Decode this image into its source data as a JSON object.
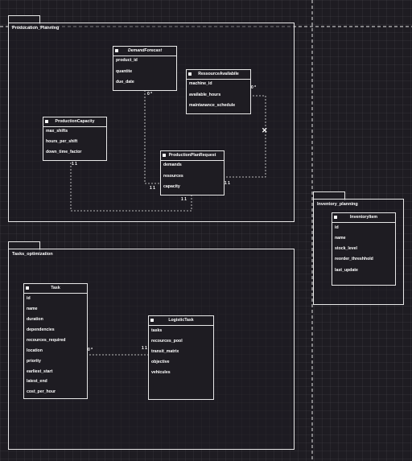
{
  "packages": {
    "production": {
      "label": "Producation_Planning"
    },
    "tasks": {
      "label": "Tasks_optimization"
    },
    "inventory": {
      "label": "Inventory_planning"
    }
  },
  "classes": {
    "demand_forecast": {
      "name": "DemandForecast",
      "attributes": [
        "product_id",
        "quantite",
        "due_date"
      ]
    },
    "resource_available": {
      "name": "RessourceAvailabile",
      "attributes": [
        "machine_id",
        "available_hours",
        "maintanance_schedule"
      ]
    },
    "production_capacity": {
      "name": "ProductionCapacity",
      "attributes": [
        "max_shifts",
        "hours_per_shift",
        "down_time_factor"
      ]
    },
    "production_plan_request": {
      "name": "ProductionPlanRequest",
      "attributes": [
        "demands",
        "resources",
        "capacity"
      ]
    },
    "task": {
      "name": "Task",
      "attributes": [
        "id",
        "name",
        "duration",
        "dependencies",
        "recources_required",
        "location",
        "priority",
        "earliest_start",
        "latest_end",
        "cost_per_hour"
      ]
    },
    "logistic_task": {
      "name": "LogisticTask",
      "attributes": [
        "tasks",
        "recources_pool",
        "transit_matrix",
        "objective",
        "vehicules"
      ]
    },
    "inventory_item": {
      "name": "InventoryItem",
      "attributes": [
        "id",
        "name",
        "stock_level",
        "reorder_threshhold",
        "last_update"
      ]
    }
  },
  "multiplicities": {
    "demand_to_plan_source": "0 *",
    "demand_to_plan_target": "1 1",
    "resource_to_plan_source": "0 *",
    "resource_to_plan_target": "1 1",
    "capacity_to_plan_source": "1 1",
    "capacity_to_plan_target": "1 1",
    "task_to_logistic_source": "0 *",
    "task_to_logistic_target": "1 1"
  },
  "colors": {
    "background": "#1e1c22",
    "line": "#e8e8e8",
    "text": "#ffffff"
  },
  "icons": {
    "class_marker": "square-icon",
    "composition_marker": "x-icon"
  }
}
